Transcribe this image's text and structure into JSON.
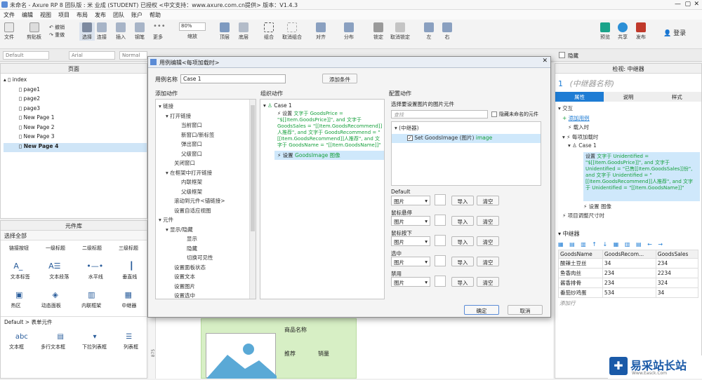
{
  "window": {
    "title": "未命名 - Axure RP 8 团队版 : 米 业成 (STUDENT) 已授权   <中文支持：www.axure.com.cn提供> 版本：V1.4.3"
  },
  "menu": [
    "文件",
    "编辑",
    "视图",
    "项目",
    "布局",
    "发布",
    "团队",
    "账户",
    "帮助"
  ],
  "toolbar": {
    "file": "文件",
    "clipboard": "剪贴板",
    "undo": "撤销",
    "redo": "重做",
    "select": "选择",
    "connect": "连接",
    "insert": "插入",
    "point": "钢笔",
    "more": "更多",
    "zoom_value": "80%",
    "zoom": "缩放",
    "top": "顶层",
    "bottom": "底层",
    "group": "组合",
    "ungroup": "取消组合",
    "align": "对齐",
    "distribute": "分布",
    "lock": "锁定",
    "unlock": "取消锁定",
    "left": "左",
    "right": "右",
    "preview": "预览",
    "share": "共享",
    "publish": "发布",
    "login": "登录"
  },
  "format": {
    "style": "Default",
    "font": "Arial",
    "weight": "Normal",
    "hide": "隐藏"
  },
  "pages": {
    "header": "页面",
    "root": "index",
    "items": [
      "page1",
      "page2",
      "page3",
      "New Page 1",
      "New Page 2",
      "New Page 3",
      "New Page 4"
    ]
  },
  "library": {
    "header": "元件库",
    "select_all": "选择全部",
    "row1": [
      "链接按钮",
      "一级标题",
      "二级标题",
      "三级标题"
    ],
    "row2": [
      "文本标签",
      "文本段落",
      "水平线",
      "垂直线"
    ],
    "row3": [
      "热区",
      "动态面板",
      "内联框架",
      "中继器"
    ],
    "section": "Default > 表单元件",
    "row4": [
      "文本框",
      "多行文本框",
      "下拉列表框",
      "列表框"
    ]
  },
  "dialog": {
    "title": "用例编辑<每项加载时>",
    "case_label": "用例名称",
    "case_value": "Case 1",
    "add_condition": "添加条件",
    "add_action_title": "添加动作",
    "organize_title": "组织动作",
    "configure_title": "配置动作",
    "actions": [
      "链接",
      "打开链接",
      "当前窗口",
      "新窗口/新标签",
      "弹出窗口",
      "父级窗口",
      "关闭窗口",
      "在框架中打开链接",
      "内联框架",
      "父级框架",
      "滚动到元件<锚链接>",
      "设置自适应视图",
      "元件",
      "显示/隐藏",
      "显示",
      "隐藏",
      "切换可见性",
      "设置面板状态",
      "设置文本",
      "设置图片",
      "设置选中"
    ],
    "org_case": "Case 1",
    "org_action1": {
      "verb": "设置",
      "text": "文字于 GoodsPrice = \"$[[Item.GoodsPrice]]\", and 文字于 GoodsSales = \"[[Item.GoodsRecommend]]人推荐\", and 文字于 GoodsRecommend = \"[[Item.GoodsRecommend]]人推荐\", and 文字于 GoodsName = \"[[Item.GoodsName]]\""
    },
    "org_action2": {
      "verb": "设置",
      "text": "GoodsImage 图像"
    },
    "config_select": "选择要设置图片的图片元件",
    "search_placeholder": "查找",
    "hide_unnamed": "隐藏未命名的元件",
    "repeater_node": "(中继器)",
    "config_item": "Set GoodsImage (图片)",
    "config_item_tag": "image",
    "states": [
      {
        "label": "Default",
        "value": "图片"
      },
      {
        "label": "鼠标悬停",
        "value": "图片"
      },
      {
        "label": "鼠标按下",
        "value": "图片"
      },
      {
        "label": "选中",
        "value": "图片"
      },
      {
        "label": "禁用",
        "value": "图片"
      }
    ],
    "import": "导入",
    "clear": "清空",
    "ok": "确定",
    "cancel": "取消"
  },
  "inspector": {
    "header": "检视: 中继器",
    "number": "1",
    "name_placeholder": "(中继器名称)",
    "tabs": [
      "属性",
      "说明",
      "样式"
    ],
    "interact": "交互",
    "add_case": "添加用例",
    "loaded": "载入时",
    "item_loaded": "每项加载时",
    "case1": "Case 1",
    "set_label": "设置",
    "set_text": "文字于 Unidentified = \"$[[Item.GoodsPrice]]\", and 文字于 Unidentified = \"已售[[Item.GoodsSales]]份\", and 文字于 Unidentified = \"[[Item.GoodsRecommend]]人推荐\", and 文字于 Unidentified = \"[[Item.GoodsName]]\"",
    "set_image": "设置 图像",
    "resize": "项目调整尺寸时",
    "repeater_title": "中继器",
    "columns": [
      "GoodsName",
      "GoodsRecom...",
      "GoodsSales"
    ],
    "rows": [
      [
        "酸辣土豆丝",
        "34",
        "234"
      ],
      [
        "鱼香肉丝",
        "234",
        "2234"
      ],
      [
        "酱香排骨",
        "234",
        "324"
      ],
      [
        "番茄炒鸡蛋",
        "534",
        "34"
      ]
    ],
    "add_row": "添加行"
  },
  "canvas": {
    "product_name": "商品名称",
    "recommend": "推荐",
    "sales": "销量",
    "ruler": "875"
  },
  "watermark": {
    "text": "易采站长站",
    "sub": "Www.Easck.Com"
  }
}
